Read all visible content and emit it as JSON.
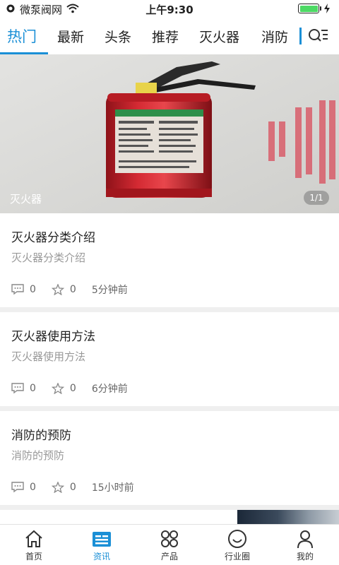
{
  "status_bar": {
    "carrier": "微泵阀网",
    "time": "上午9:30"
  },
  "tabs": [
    {
      "label": "热门",
      "active": true
    },
    {
      "label": "最新"
    },
    {
      "label": "头条"
    },
    {
      "label": "推荐"
    },
    {
      "label": "灭火器"
    },
    {
      "label": "消防"
    }
  ],
  "hero": {
    "caption": "灭火器",
    "pager": "1/1"
  },
  "news": [
    {
      "title": "灭火器分类介绍",
      "summary": "灭火器分类介绍",
      "comments": "0",
      "stars": "0",
      "time": "5分钟前"
    },
    {
      "title": "灭火器使用方法",
      "summary": "灭火器使用方法",
      "comments": "0",
      "stars": "0",
      "time": "6分钟前"
    },
    {
      "title": "消防的预防",
      "summary": "消防的预防",
      "comments": "0",
      "stars": "0",
      "time": "15小时前"
    }
  ],
  "bottom_nav": [
    {
      "label": "首页",
      "icon": "home-icon"
    },
    {
      "label": "资讯",
      "icon": "news-icon",
      "active": true
    },
    {
      "label": "产品",
      "icon": "grid-icon"
    },
    {
      "label": "行业圈",
      "icon": "smiley-icon"
    },
    {
      "label": "我的",
      "icon": "person-icon"
    }
  ],
  "colors": {
    "accent": "#1a8fd6",
    "extinguisher_red": "#c8202a",
    "divider": "#efefef"
  }
}
